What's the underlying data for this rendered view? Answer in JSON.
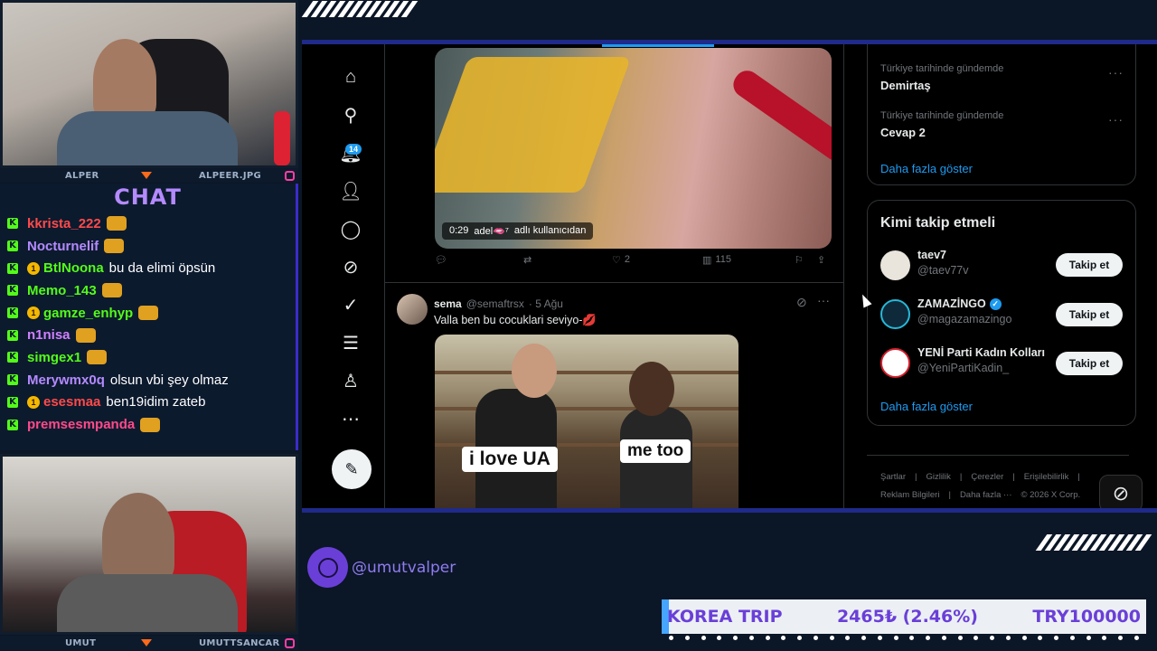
{
  "streamer_top": {
    "left_name": "ALPER",
    "right_name": "ALPEER.JPG"
  },
  "streamer_bottom": {
    "left_name": "UMUT",
    "right_name": "UMUTTSANCAR"
  },
  "chat": {
    "title": "CHAT",
    "messages": [
      {
        "user": "kkrista_222",
        "color": "#ff4a4a",
        "text": "",
        "badge": ""
      },
      {
        "user": "Nocturnelif",
        "color": "#b48aff",
        "text": "",
        "badge": ""
      },
      {
        "user": "BtlNoona",
        "color": "#53fc18",
        "text": "bu da elimi öpsün",
        "badge": "1"
      },
      {
        "user": "Memo_143",
        "color": "#53fc18",
        "text": "",
        "badge": ""
      },
      {
        "user": "gamze_enhyp",
        "color": "#53fc18",
        "text": "",
        "badge": "1"
      },
      {
        "user": "n1nisa",
        "color": "#d080ff",
        "text": "",
        "badge": ""
      },
      {
        "user": "simgex1",
        "color": "#53fc18",
        "text": "",
        "badge": ""
      },
      {
        "user": "Merywmx0q",
        "color": "#b48aff",
        "text": "olsun vbi şey olmaz",
        "badge": ""
      },
      {
        "user": "esesmaa",
        "color": "#ff4a4a",
        "text": "ben19idim zateb",
        "badge": "1"
      },
      {
        "user": "premsesmpanda",
        "color": "#ff4a8a",
        "text": "",
        "badge": ""
      }
    ]
  },
  "twitter": {
    "notif_count": "14",
    "video": {
      "time": "0:29",
      "overlay_user": "adel🫦⁷",
      "overlay_text": "adlı kullanıcıdan"
    },
    "video_actions": {
      "likes": "2",
      "views": "115"
    },
    "post": {
      "name": "sema",
      "handle": "@semaftrsx",
      "date": "· 5 Ağu",
      "text": "Valla ben bu cocuklari seviyo-💋",
      "caption_left": "i love UA",
      "caption_right": "me too"
    },
    "trends": [
      {
        "label": "Türkiye tarihinde gündemde",
        "name": "Demirtaş"
      },
      {
        "label": "Türkiye tarihinde gündemde",
        "name": "Cevap 2"
      }
    ],
    "show_more": "Daha fazla göster",
    "who_to_follow": {
      "title": "Kimi takip etmeli",
      "follow_label": "Takip et",
      "accounts": [
        {
          "name": "taev7",
          "handle": "@taev77v",
          "verified": false
        },
        {
          "name": "ZAMAZİNGO",
          "handle": "@magazamazingo",
          "verified": true
        },
        {
          "name": "YENİ Parti Kadın Kolları",
          "handle": "@YeniPartiKadin_",
          "verified": false
        }
      ],
      "show_more": "Daha fazla göster"
    },
    "footer": {
      "row1": [
        "Şartlar",
        "|",
        "Gizlilik",
        "|",
        "Çerezler",
        "|",
        "Erişilebilirlik",
        "|"
      ],
      "row2": [
        "Reklam Bilgileri",
        "|",
        "Daha fazla ···",
        "© 2026 X Corp."
      ]
    }
  },
  "social_handle": "@umutvalper",
  "ticker": {
    "label": "KOREA TRIP",
    "value": "2465₺ (2.46%)",
    "goal": "TRY100000"
  }
}
